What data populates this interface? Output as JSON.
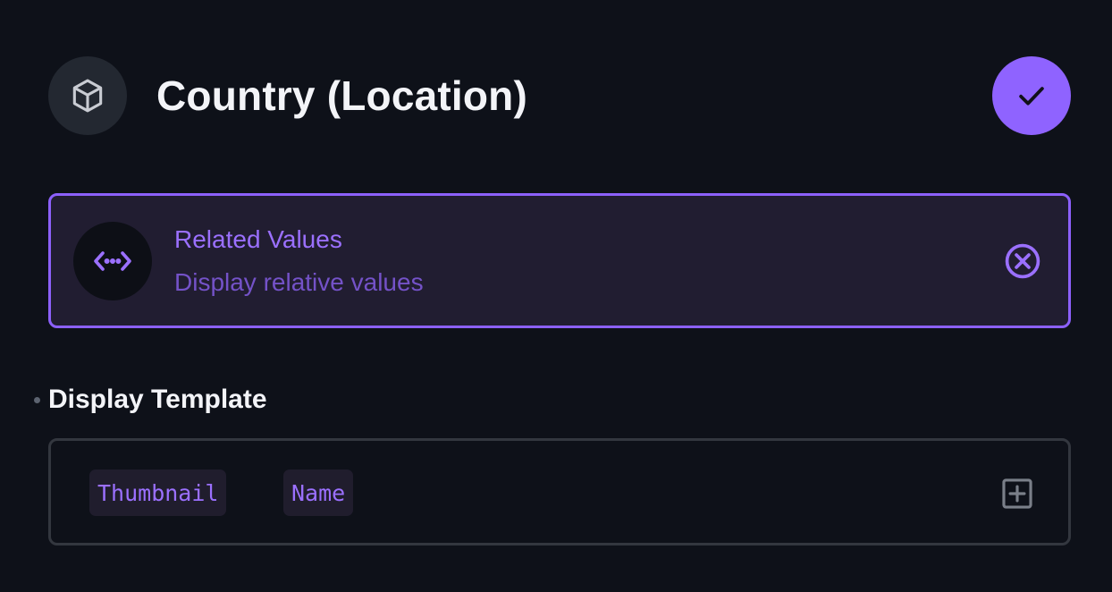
{
  "header": {
    "title": "Country (Location)",
    "icon": "cube-icon",
    "confirm_icon": "check-icon"
  },
  "interface": {
    "title": "Related Values",
    "subtitle": "Display relative values",
    "icon": "code-brackets-icon",
    "remove_icon": "close-circle-icon"
  },
  "display_template": {
    "label": "Display Template",
    "chips": [
      "Thumbnail",
      "Name"
    ],
    "add_icon": "add-box-icon"
  },
  "colors": {
    "background": "#0e1119",
    "accent": "#8f63ff",
    "card_background": "#211d31",
    "chip_text": "#9b70ff"
  }
}
